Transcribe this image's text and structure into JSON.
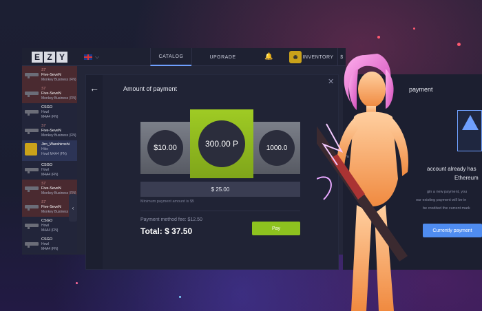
{
  "header": {
    "logo_letters": [
      "E",
      "Z",
      "Y"
    ],
    "tabs": [
      {
        "label": "CATALOG",
        "active": true
      },
      {
        "label": "UPGRADE",
        "active": false
      }
    ],
    "inventory_label": "INVENTORY",
    "balance_partial": "$"
  },
  "sidebar": {
    "items": [
      {
        "name": "Five-SeveN",
        "sub": "Monkey Business (FN)",
        "badge": "ST",
        "style": "red"
      },
      {
        "name": "Five-SeveN",
        "sub": "Monkey Business (FN)",
        "badge": "ST",
        "style": "red"
      },
      {
        "name": "CSGO",
        "sub": "Howl",
        "sub2": "M4A4 (FN)",
        "style": "dark"
      },
      {
        "name": "Five-SeveN",
        "sub": "Monkey Business (FN)",
        "badge": "ST",
        "style": "dark"
      },
      {
        "name": "Jiro_Warahiroshi",
        "sub": "Hiko",
        "sub2": "Howl M4A4 (FN)",
        "style": "blue"
      },
      {
        "name": "CSGO",
        "sub": "Howl",
        "sub2": "M4A4 (FN)",
        "style": "dark"
      },
      {
        "name": "Five-SeveN",
        "sub": "Monkey Business (FN)",
        "badge": "ST",
        "style": "red"
      },
      {
        "name": "Five-SeveN",
        "sub": "Monkey Business (FN)",
        "badge": "ST",
        "style": "red"
      },
      {
        "name": "CSGO",
        "sub": "Howl",
        "sub2": "M4A4 (FN)",
        "style": "dark"
      },
      {
        "name": "CSGO",
        "sub": "Howl",
        "sub2": "M4A4 (FN)",
        "style": "dark"
      }
    ]
  },
  "modal": {
    "title": "Amount of payment",
    "cards": [
      {
        "value": "$10.00",
        "selected": false
      },
      {
        "value": "300.00 P",
        "selected": true
      },
      {
        "value": "1000.0",
        "selected": false
      }
    ],
    "amount_value": "$ 25.00",
    "min_note": "Minimum payment amount is $5",
    "fee_text": "Payment method fee: $12.50",
    "total_text": "Total: $ 37.50",
    "pay_label": "Pay"
  },
  "right_panel": {
    "title": "payment",
    "line1": "account already has",
    "line2": "Ethereum",
    "small1": "Pa",
    "small2": "gin a new payment, you",
    "small3": "our existing payment will be in",
    "small4": "be credited the current mark",
    "button_label": "Currently payment"
  },
  "colors": {
    "accent_green": "#8dc21f",
    "accent_blue": "#4f8cf0",
    "panel_bg": "#1c1f30"
  }
}
